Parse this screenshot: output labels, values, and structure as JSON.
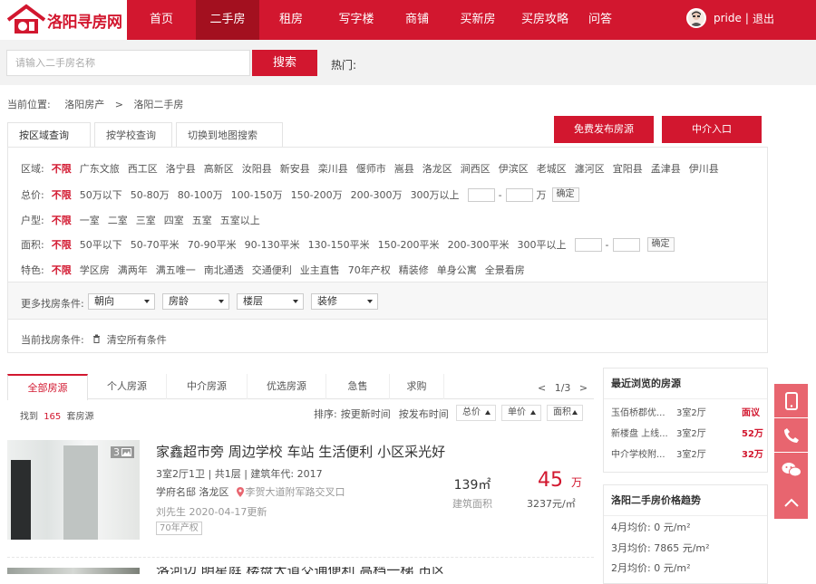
{
  "header": {
    "logo_text": "洛阳寻房网",
    "nav": [
      "首页",
      "二手房",
      "租房",
      "写字楼",
      "商铺",
      "买新房",
      "买房攻略",
      "问答"
    ],
    "active_nav": "二手房",
    "user": {
      "name": "pride",
      "sep": "|",
      "logout": "退出"
    }
  },
  "search": {
    "placeholder": "请输入二手房名称",
    "button": "搜索",
    "hot_label": "热门:"
  },
  "breadcrumb": {
    "prefix": "当前位置:",
    "items": [
      "洛阳房产",
      "洛阳二手房"
    ],
    "sep": ">"
  },
  "filter_tabs": [
    "按区域查询",
    "按学校查询",
    "切换到地图搜索"
  ],
  "actions": {
    "publish": "免费发布房源",
    "agent": "中介入口"
  },
  "filters": {
    "region": {
      "label": "区域:",
      "options": [
        "不限",
        "广东文旅",
        "西工区",
        "洛宁县",
        "高新区",
        "汝阳县",
        "新安县",
        "栾川县",
        "偃师市",
        "嵩县",
        "洛龙区",
        "涧西区",
        "伊滨区",
        "老城区",
        "瀍河区",
        "宜阳县",
        "孟津县",
        "伊川县"
      ]
    },
    "price": {
      "label": "总价:",
      "options": [
        "不限",
        "50万以下",
        "50-80万",
        "80-100万",
        "100-150万",
        "150-200万",
        "200-300万",
        "300万以上"
      ],
      "dash": "-",
      "unit": "万",
      "ok": "确定"
    },
    "layout": {
      "label": "户型:",
      "options": [
        "不限",
        "一室",
        "二室",
        "三室",
        "四室",
        "五室",
        "五室以上"
      ]
    },
    "area": {
      "label": "面积:",
      "options": [
        "不限",
        "50平以下",
        "50-70平米",
        "70-90平米",
        "90-130平米",
        "130-150平米",
        "150-200平米",
        "200-300平米",
        "300平以上"
      ],
      "dash": "-",
      "ok": "确定"
    },
    "feature": {
      "label": "特色:",
      "options": [
        "不限",
        "学区房",
        "满两年",
        "满五唯一",
        "南北通透",
        "交通便利",
        "业主直售",
        "70年产权",
        "精装修",
        "单身公寓",
        "全景看房"
      ]
    },
    "more_label": "更多找房条件:",
    "dropdowns": [
      "朝向",
      "房龄",
      "楼层",
      "装修"
    ],
    "current_label": "当前找房条件:",
    "clear_label": "清空所有条件"
  },
  "list": {
    "tabs": [
      "全部房源",
      "个人房源",
      "中介房源",
      "优选房源",
      "急售",
      "求购"
    ],
    "pager": {
      "prev": "<",
      "text": "1/3",
      "next": ">"
    },
    "found_prefix": "找到",
    "found_count": "165",
    "found_suffix": "套房源",
    "sort_label": "排序:",
    "sort_options": [
      "按更新时间",
      "按发布时间"
    ],
    "sort_boxes": [
      "总价",
      "单价",
      "面积"
    ],
    "items": [
      {
        "photo_count": "3",
        "title": "家鑫超市旁 周边学校 车站 生活便利 小区采光好",
        "meta": "3室2厅1卫  |  共1层  |  建筑年代: 2017",
        "community": "学府名邸 洛龙区",
        "address": "李贺大道附军路交叉口",
        "agent_update": "刘先生    2020-04-17更新",
        "tag": "70年产权",
        "area": "139㎡",
        "area_label": "建筑面积",
        "price": "45",
        "price_unit": "万",
        "unit_price": "3237元/㎡"
      },
      {
        "title": "洛河边 明星庭 楼盘大道交通便利 高档一梯 市区"
      }
    ]
  },
  "sidebar": {
    "recent_title": "最近浏览的房源",
    "recent": [
      {
        "name": "玉佰桥郡优...",
        "rooms": "3室2厅",
        "price": "面议"
      },
      {
        "name": "新楼盘 上线...",
        "rooms": "3室2厅",
        "price": "52万"
      },
      {
        "name": "中介学校附...",
        "rooms": "3室2厅",
        "price": "32万"
      }
    ],
    "trend_title": "洛阳二手房价格趋势",
    "trend": [
      "4月均价: 0 元/m²",
      "3月均价: 7865 元/m²",
      "2月均价: 0 元/m²"
    ]
  },
  "colors": {
    "brand": "#d2172f",
    "brand_dark": "#a3101f",
    "float": "#e8656f"
  }
}
